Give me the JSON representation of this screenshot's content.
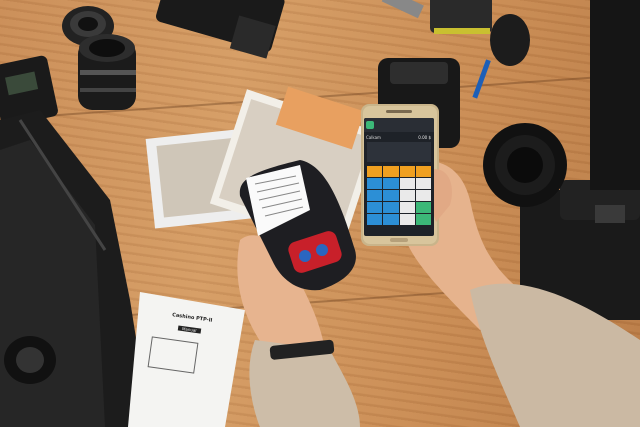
{
  "photo": {
    "description_hidden": "",
    "colors": {
      "table": "#cf9660",
      "printer_body": "#1e1e22",
      "printer_button": "#c8202a",
      "phone_gold": "#c9b48a",
      "screen_keys_orange": "#f0a020",
      "screen_keys_blue": "#2c8fd6",
      "screen_keys_green": "#3cb878",
      "sleeve_beige": "#c9b7a3"
    }
  },
  "phone": {
    "screen_title": "Calkam",
    "screen_total": "0.00 $"
  },
  "manual": {
    "title": "Cashino PTP-II",
    "subtitle": "Manual"
  }
}
